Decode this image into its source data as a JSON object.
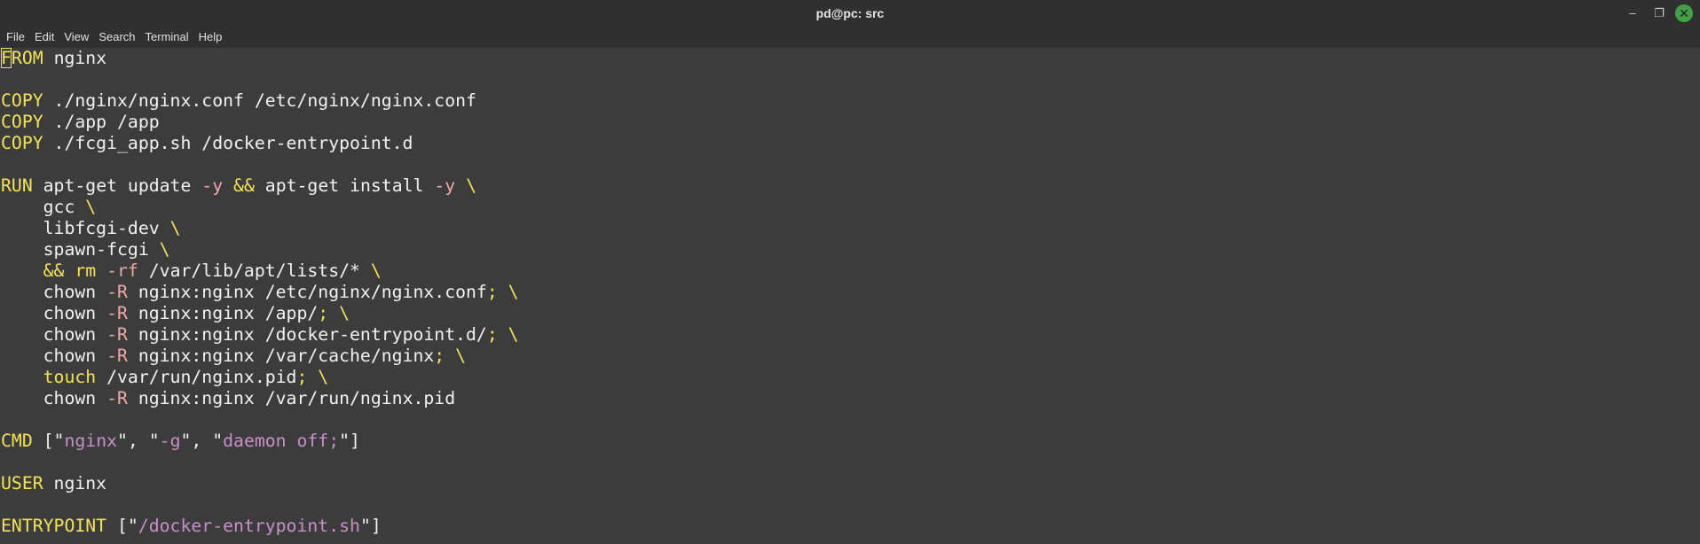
{
  "window": {
    "title": "pd@pc: src",
    "controls": {
      "minimize": "–",
      "maximize": "❐",
      "close": "✕"
    }
  },
  "menu": [
    "File",
    "Edit",
    "View",
    "Search",
    "Terminal",
    "Help"
  ],
  "colors": {
    "background": "#3c3c3c",
    "titlebar": "#303030",
    "keyword": "#f2e35a",
    "flag": "#f2a7a7",
    "string": "#c98fc9",
    "text": "#f2f2f2",
    "close_button": "#43a047"
  },
  "terminal": {
    "lines": [
      [
        {
          "t": "F",
          "c": "kw cursor"
        },
        {
          "t": "ROM",
          "c": "kw"
        },
        {
          "t": " nginx",
          "c": ""
        }
      ],
      [],
      [
        {
          "t": "COPY",
          "c": "kw"
        },
        {
          "t": " ./nginx/nginx.conf /etc/nginx/nginx.conf",
          "c": ""
        }
      ],
      [
        {
          "t": "COPY",
          "c": "kw"
        },
        {
          "t": " ./app /app",
          "c": ""
        }
      ],
      [
        {
          "t": "COPY",
          "c": "kw"
        },
        {
          "t": " ./fcgi_app.sh /docker-entrypoint.d",
          "c": ""
        }
      ],
      [],
      [
        {
          "t": "RUN",
          "c": "kw"
        },
        {
          "t": " apt-get update ",
          "c": ""
        },
        {
          "t": "-y",
          "c": "flag"
        },
        {
          "t": " ",
          "c": ""
        },
        {
          "t": "&&",
          "c": "op"
        },
        {
          "t": " apt-get install ",
          "c": ""
        },
        {
          "t": "-y",
          "c": "flag"
        },
        {
          "t": " ",
          "c": ""
        },
        {
          "t": "\\",
          "c": "op"
        }
      ],
      [
        {
          "t": "    gcc ",
          "c": ""
        },
        {
          "t": "\\",
          "c": "op"
        }
      ],
      [
        {
          "t": "    libfcgi-dev ",
          "c": ""
        },
        {
          "t": "\\",
          "c": "op"
        }
      ],
      [
        {
          "t": "    spawn-fcgi ",
          "c": ""
        },
        {
          "t": "\\",
          "c": "op"
        }
      ],
      [
        {
          "t": "    ",
          "c": ""
        },
        {
          "t": "&& rm",
          "c": "op"
        },
        {
          "t": " ",
          "c": ""
        },
        {
          "t": "-rf",
          "c": "flag"
        },
        {
          "t": " /var/lib/apt/lists/* ",
          "c": ""
        },
        {
          "t": "\\",
          "c": "op"
        }
      ],
      [
        {
          "t": "    chown ",
          "c": ""
        },
        {
          "t": "-R",
          "c": "flag"
        },
        {
          "t": " nginx:nginx /etc/nginx/nginx.conf",
          "c": ""
        },
        {
          "t": "; \\",
          "c": "op"
        }
      ],
      [
        {
          "t": "    chown ",
          "c": ""
        },
        {
          "t": "-R",
          "c": "flag"
        },
        {
          "t": " nginx:nginx /app/",
          "c": ""
        },
        {
          "t": "; \\",
          "c": "op"
        }
      ],
      [
        {
          "t": "    chown ",
          "c": ""
        },
        {
          "t": "-R",
          "c": "flag"
        },
        {
          "t": " nginx:nginx /docker-entrypoint.d/",
          "c": ""
        },
        {
          "t": "; \\",
          "c": "op"
        }
      ],
      [
        {
          "t": "    chown ",
          "c": ""
        },
        {
          "t": "-R",
          "c": "flag"
        },
        {
          "t": " nginx:nginx /var/cache/nginx",
          "c": ""
        },
        {
          "t": "; \\",
          "c": "op"
        }
      ],
      [
        {
          "t": "    ",
          "c": ""
        },
        {
          "t": "touch",
          "c": "op"
        },
        {
          "t": " /var/run/nginx.pid",
          "c": ""
        },
        {
          "t": "; \\",
          "c": "op"
        }
      ],
      [
        {
          "t": "    chown ",
          "c": ""
        },
        {
          "t": "-R",
          "c": "flag"
        },
        {
          "t": " nginx:nginx /var/run/nginx.pid",
          "c": ""
        }
      ],
      [],
      [
        {
          "t": "CMD",
          "c": "kw"
        },
        {
          "t": " [\"",
          "c": ""
        },
        {
          "t": "nginx",
          "c": "str"
        },
        {
          "t": "\", \"",
          "c": ""
        },
        {
          "t": "-g",
          "c": "str"
        },
        {
          "t": "\", \"",
          "c": ""
        },
        {
          "t": "daemon off;",
          "c": "str"
        },
        {
          "t": "\"]",
          "c": ""
        }
      ],
      [],
      [
        {
          "t": "USER",
          "c": "kw"
        },
        {
          "t": " nginx",
          "c": ""
        }
      ],
      [],
      [
        {
          "t": "ENTRYPOINT",
          "c": "kw"
        },
        {
          "t": " [\"",
          "c": ""
        },
        {
          "t": "/docker-entrypoint.sh",
          "c": "str"
        },
        {
          "t": "\"]",
          "c": ""
        }
      ]
    ]
  }
}
